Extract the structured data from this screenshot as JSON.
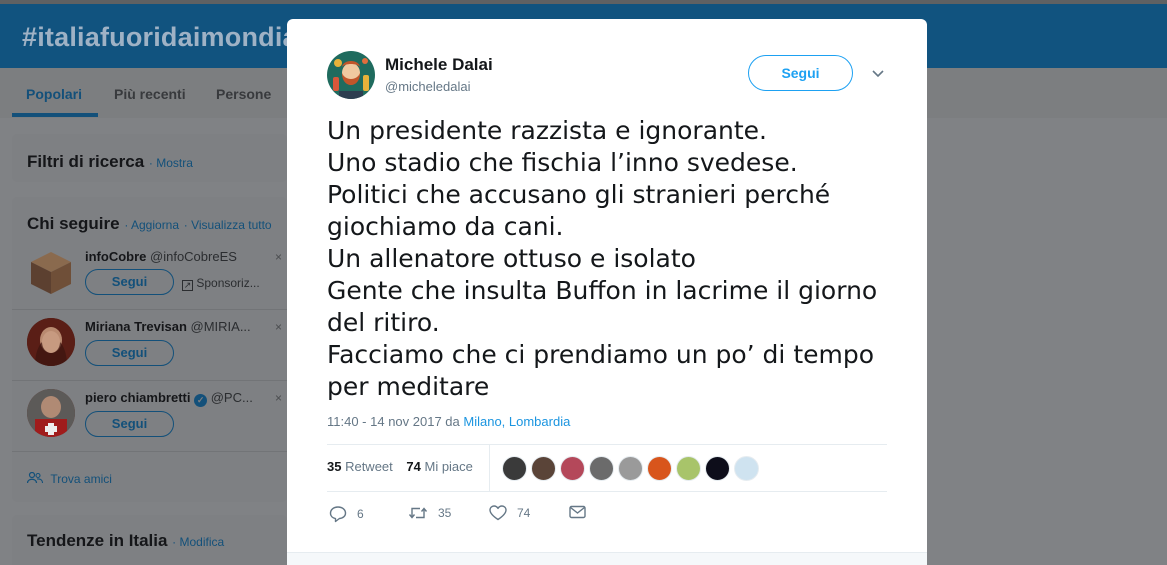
{
  "background": {
    "banner_title": "#italiafuoridaimondia",
    "nav": {
      "tab_popular": "Popolari",
      "tab_recent": "Più recenti",
      "tab_people": "Persone"
    },
    "search_filters": {
      "title": "Filtri di ricerca",
      "show_link": "· Mostra"
    },
    "who_to_follow": {
      "title": "Chi seguire",
      "refresh_link": "· Aggiorna",
      "view_all_link": "· Visualizza tutto",
      "items": [
        {
          "name": "infoCobre",
          "handle": "@infoCobreES",
          "button": "Segui",
          "promoted": "Sponsoriz..."
        },
        {
          "name": "Miriana Trevisan",
          "handle": "@MIRIA...",
          "button": "Segui"
        },
        {
          "name": "piero chiambretti",
          "handle": "@PC...",
          "button": "Segui"
        }
      ],
      "find_friends": "Trova amici",
      "dismiss": "×"
    },
    "trends": {
      "title": "Tendenze in Italia",
      "edit_link": "· Modifica"
    }
  },
  "tweet": {
    "author_name": "Michele Dalai",
    "author_handle": "@micheledalai",
    "follow_label": "Segui",
    "lines": [
      "Un presidente razzista e ignorante.",
      "Uno stadio che fischia l’inno svedese.",
      "Politici che accusano gli stranieri perché",
      "giochiamo da cani.",
      "Un allenatore ottuso e isolato",
      "Gente che insulta Buffon in lacrime il giorno",
      "del ritiro.",
      "Facciamo che ci prendiamo un po’ di tempo",
      "per meditare"
    ],
    "timestamp": "11:40 - 14 nov 2017 da ",
    "location": "Milano, Lombardia",
    "retweet_count": "35",
    "retweet_label": " Retweet",
    "like_count": "74",
    "like_label": " Mi piace",
    "reply_action_count": "6",
    "retweet_action_count": "35",
    "like_action_count": "74",
    "liker_colors": [
      "#3a3a3a",
      "#5a4438",
      "#b4485a",
      "#6b6b6b",
      "#9a9a9a",
      "#d8551c",
      "#a8c46a",
      "#0d0d1a",
      "#cfe3f0"
    ]
  },
  "colors": {
    "accent": "#1da1f2",
    "banner": "#11537f",
    "link": "#1b95e0"
  }
}
